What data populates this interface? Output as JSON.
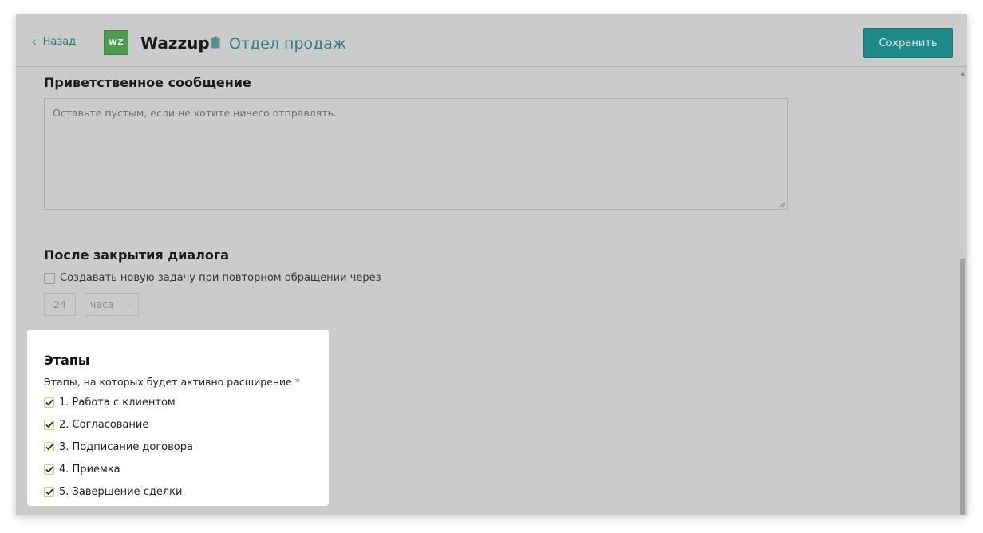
{
  "header": {
    "back_label": "Назад",
    "logo_text": "WZ",
    "app_title": "Wazzup",
    "department": "Отдел продаж",
    "save_label": "Сохранить"
  },
  "greeting": {
    "title": "Приветственное сообщение",
    "placeholder": "Оставьте пустым, если не хотите ничего отправлять."
  },
  "after_close": {
    "title": "После закрытия диалога",
    "checkbox_label": "Создавать новую задачу при повторном обращении через",
    "checkbox_checked": false,
    "interval_value": "24",
    "interval_unit": "часа"
  },
  "stages": {
    "title": "Этапы",
    "description": "Этапы, на которых будет активно расширение",
    "required_mark": "*",
    "items": [
      {
        "label": "1. Работа с клиентом",
        "checked": true
      },
      {
        "label": "2. Согласование",
        "checked": true
      },
      {
        "label": "3. Подписание договора",
        "checked": true
      },
      {
        "label": "4. Приемка",
        "checked": true
      },
      {
        "label": "5. Завершение сделки",
        "checked": true
      }
    ]
  },
  "colors": {
    "accent": "#1e8a8a",
    "overlay": "#cbcbcb",
    "check": "#c8a23a"
  },
  "icons": {
    "back": "chevron-left-icon",
    "department": "clipboard-icon",
    "stage_check": "checkmark-icon"
  }
}
